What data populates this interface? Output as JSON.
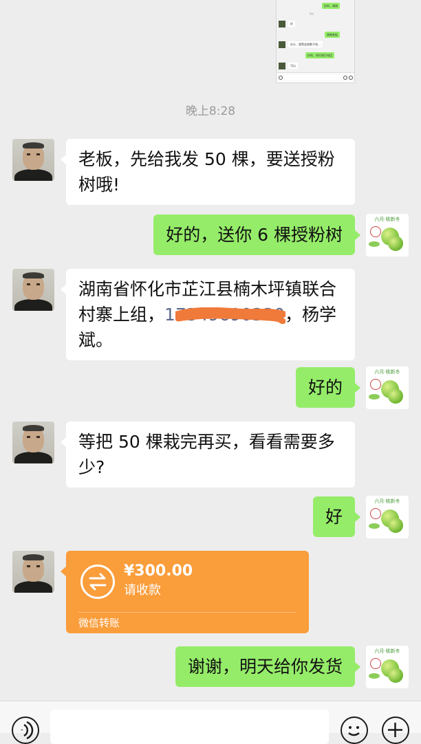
{
  "thumbnail": {
    "lines": [
      "好的，谢谢",
      "现在",
      "好",
      "谢谢老板",
      "在么…我等会收数子钱…",
      "好的，明天拨打电话",
      "可以"
    ]
  },
  "timestamp": "晚上8:28",
  "messages": [
    {
      "side": "in",
      "text": "老板，先给我发 50 棵，要送授粉树哦!"
    },
    {
      "side": "out",
      "text": "好的，送你 6 棵授粉树"
    },
    {
      "side": "in",
      "text_before": "湖南省怀化市芷江县楠木坪镇联合村寨上组，",
      "phone": "17349690330",
      "text_after": "，杨学斌。"
    },
    {
      "side": "out",
      "text": "好的"
    },
    {
      "side": "in",
      "text": "等把 50 棵栽完再买，看看需要多少?"
    },
    {
      "side": "out",
      "text": "好"
    },
    {
      "side": "out",
      "text": "谢谢，明天给你发货"
    }
  ],
  "transfer": {
    "amount": "¥300.00",
    "label": "请收款",
    "footer": "微信转账",
    "color": "#fa9d3b"
  },
  "self_avatar": {
    "caption": "六月·桃新冬"
  },
  "colors": {
    "outgoing_bubble": "#95ec69",
    "incoming_bubble": "#ffffff",
    "background": "#ededed"
  },
  "icons": {
    "voice": "voice-icon",
    "emoji": "emoji-icon",
    "more": "plus-icon"
  }
}
